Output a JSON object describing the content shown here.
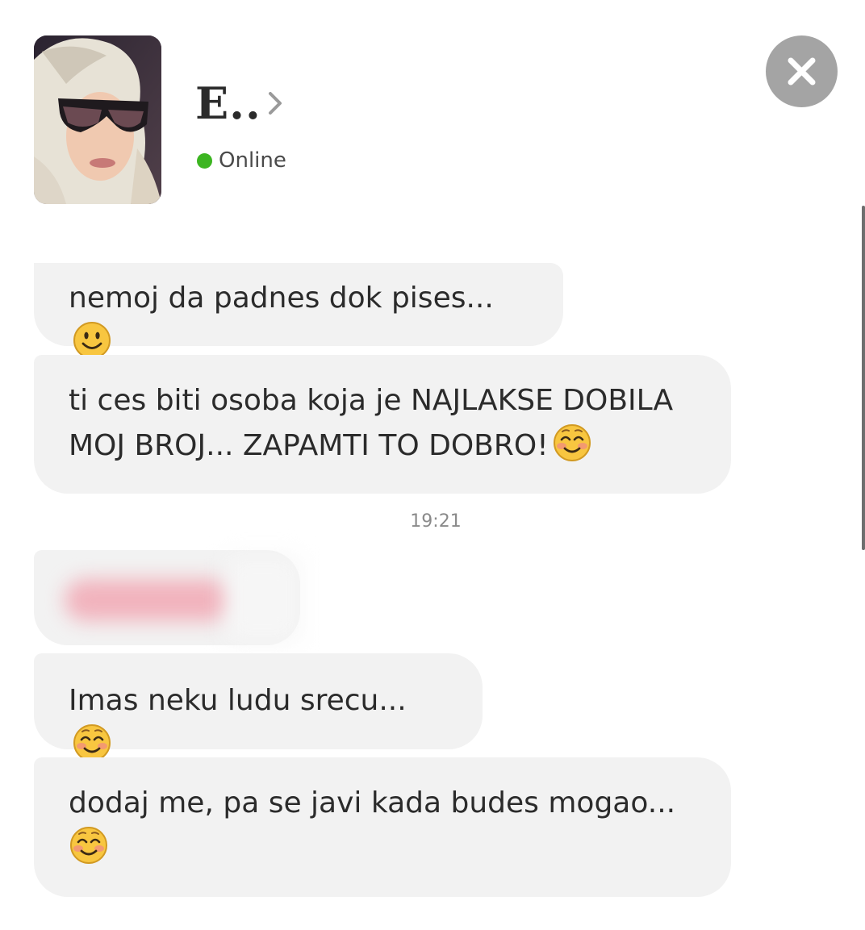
{
  "header": {
    "name": "E..",
    "status": "Online",
    "status_color": "#3cb521"
  },
  "icons": {
    "close": "close-icon",
    "chevron": "chevron-right-icon",
    "smile": "smiling-face-icon",
    "blush": "blushing-face-icon"
  },
  "messages": [
    {
      "text": "nemoj da padnes dok pises...",
      "emoji": "smiling-face-icon"
    },
    {
      "text": "ti ces biti osoba koja je NAJLAKSE DOBILA MOJ BROJ... ZAPAMTI TO DOBRO!",
      "emoji": "blushing-face-icon"
    },
    {
      "text": "Imas neku ludu srecu... ",
      "emoji": "blushing-face-icon"
    },
    {
      "text": "dodaj me, pa se javi kada budes mogao...",
      "emoji": "blushing-face-icon"
    }
  ],
  "timestamp": "19:21"
}
